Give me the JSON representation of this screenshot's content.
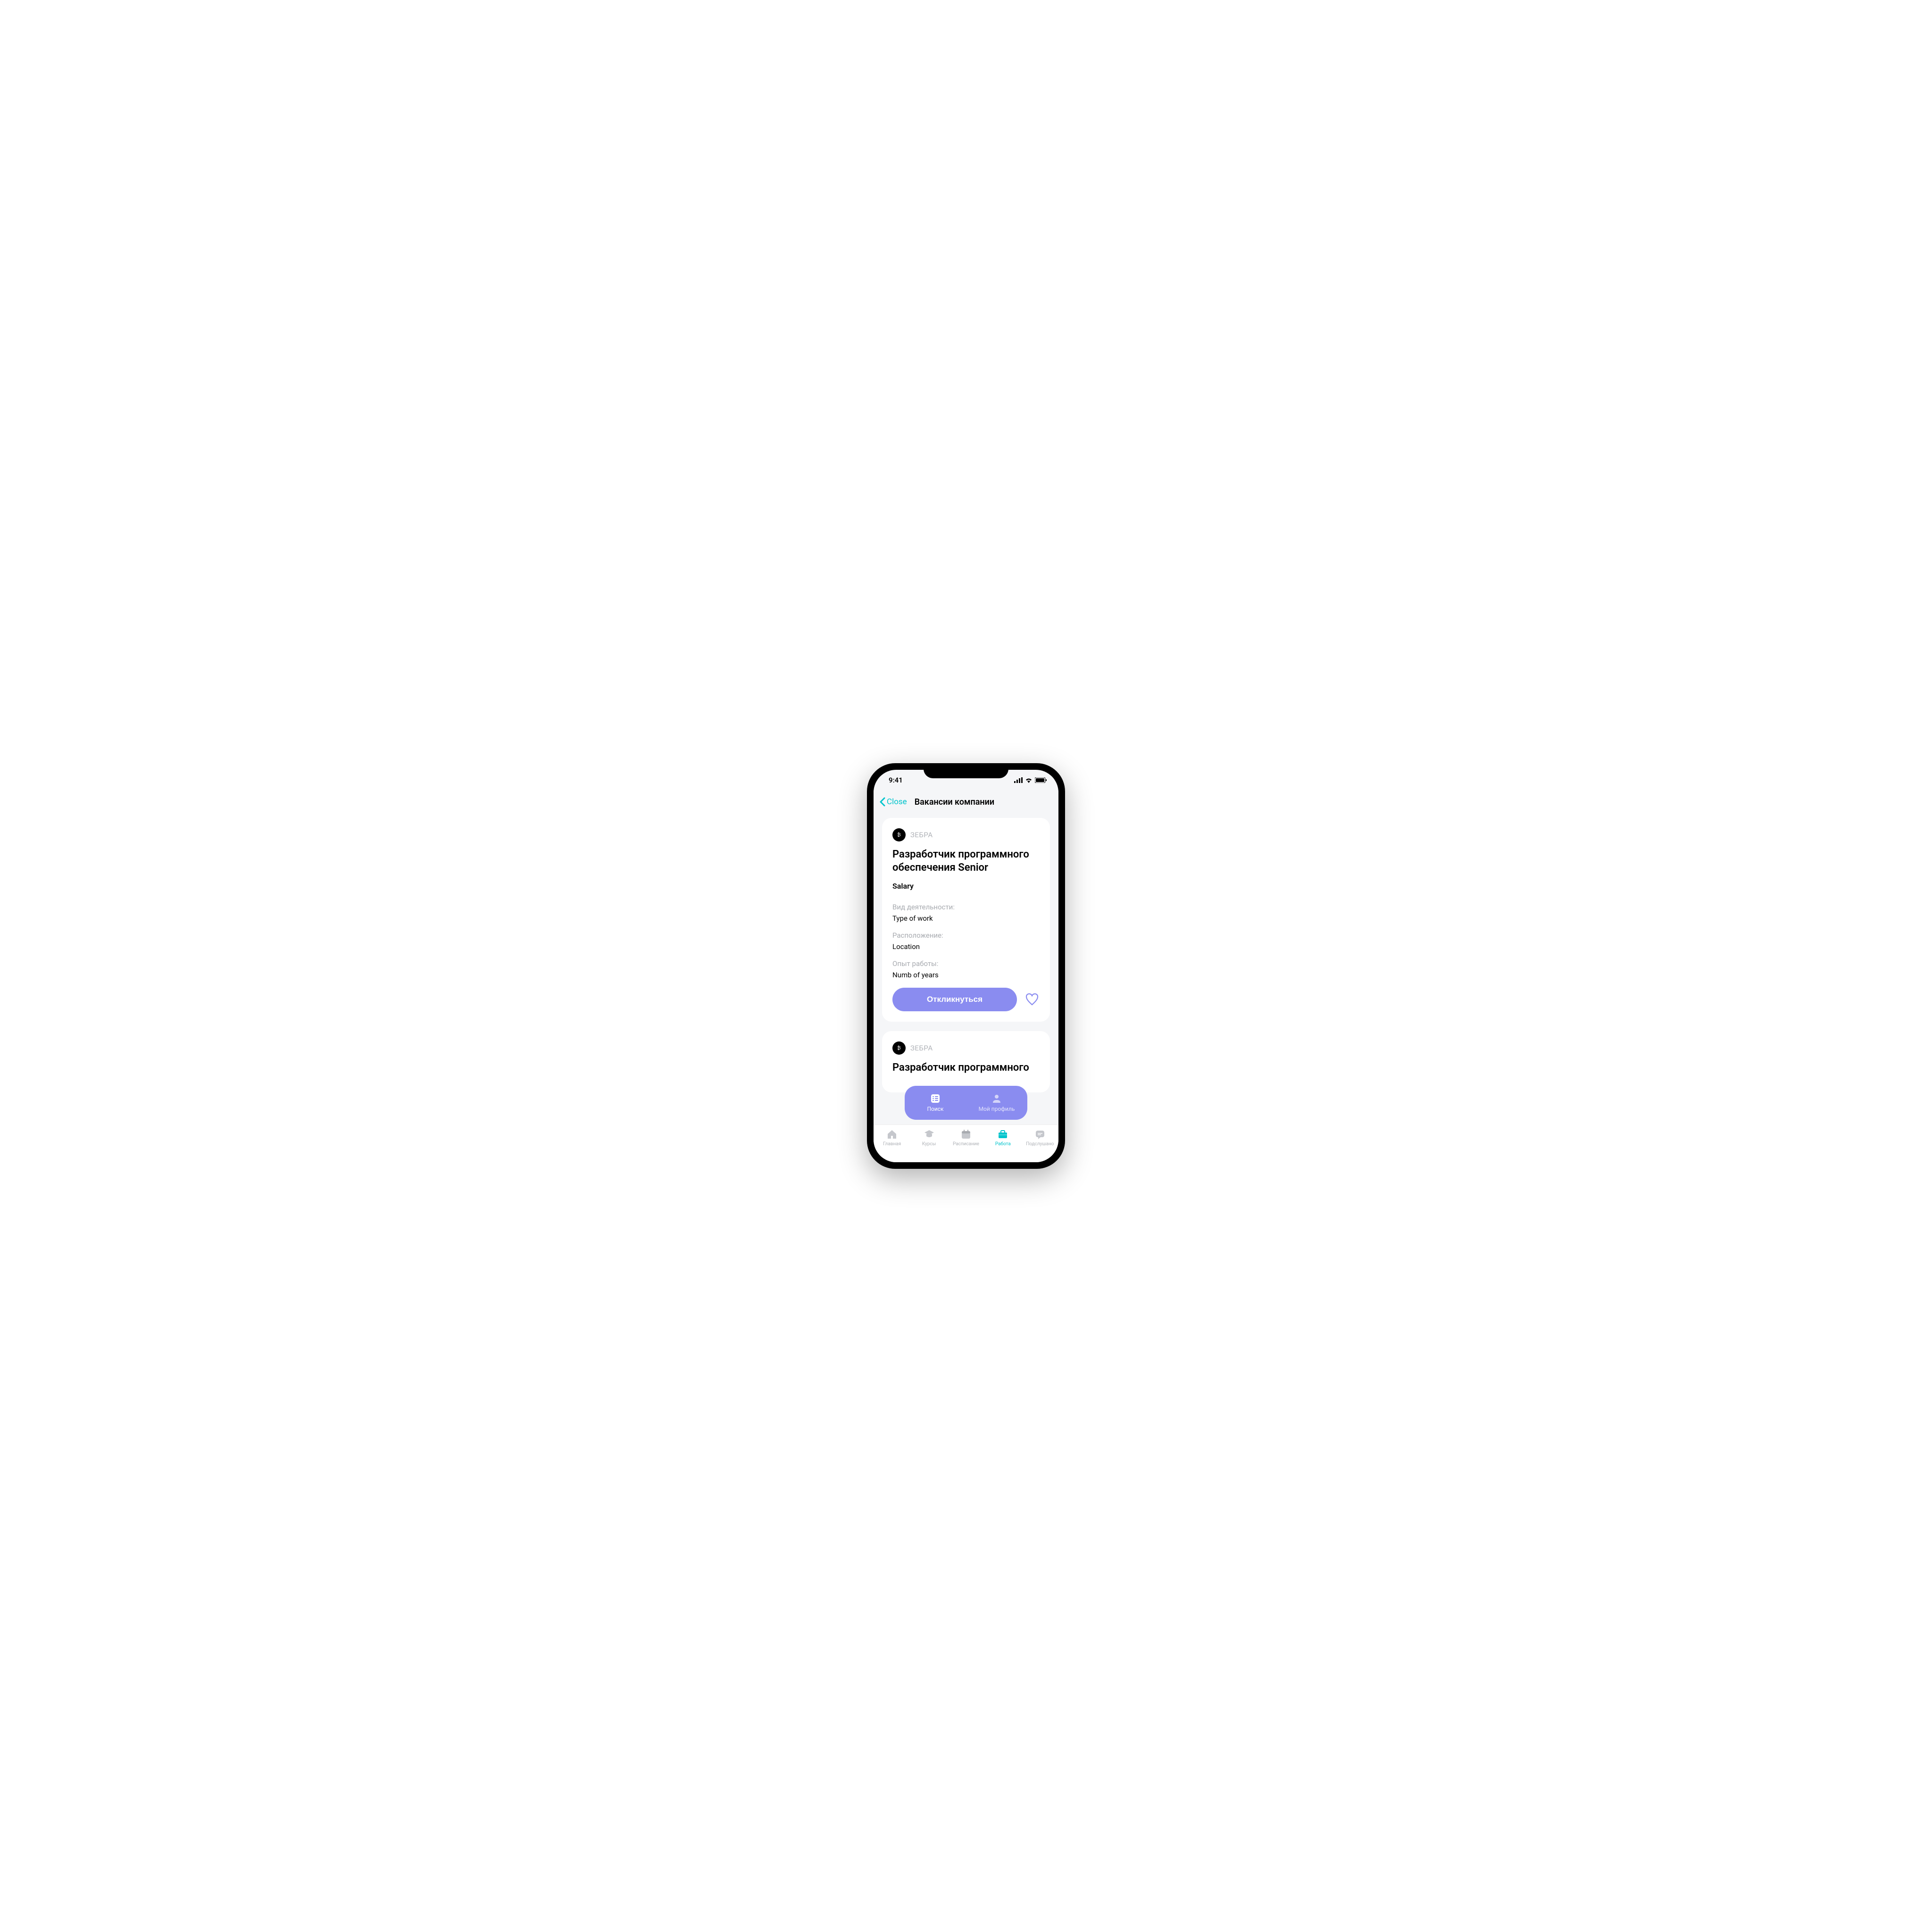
{
  "status": {
    "time": "9:41"
  },
  "nav": {
    "back_label": "Close",
    "title": "Вакансии компании"
  },
  "cards": [
    {
      "company": "ЗЕБРА",
      "title": "Разработчик программного обеспечения Senior",
      "salary": "Salary",
      "activity_label": "Вид деятельности:",
      "activity_value": "Type of work",
      "location_label": "Расположение:",
      "location_value": "Location",
      "experience_label": "Опыт работы:",
      "experience_value": "Numb of years",
      "apply": "Откликнуться"
    },
    {
      "company": "ЗЕБРА",
      "title_partial": "Разработчик программного"
    }
  ],
  "floating": {
    "search": "Поиск",
    "profile": "Мой профиль"
  },
  "tabs": {
    "home": "Главная",
    "courses": "Курсы",
    "schedule": "Расписание",
    "work": "Работа",
    "overheard": "Подслушано"
  },
  "colors": {
    "accent": "#00c4cc",
    "primary": "#8a8cf0"
  }
}
